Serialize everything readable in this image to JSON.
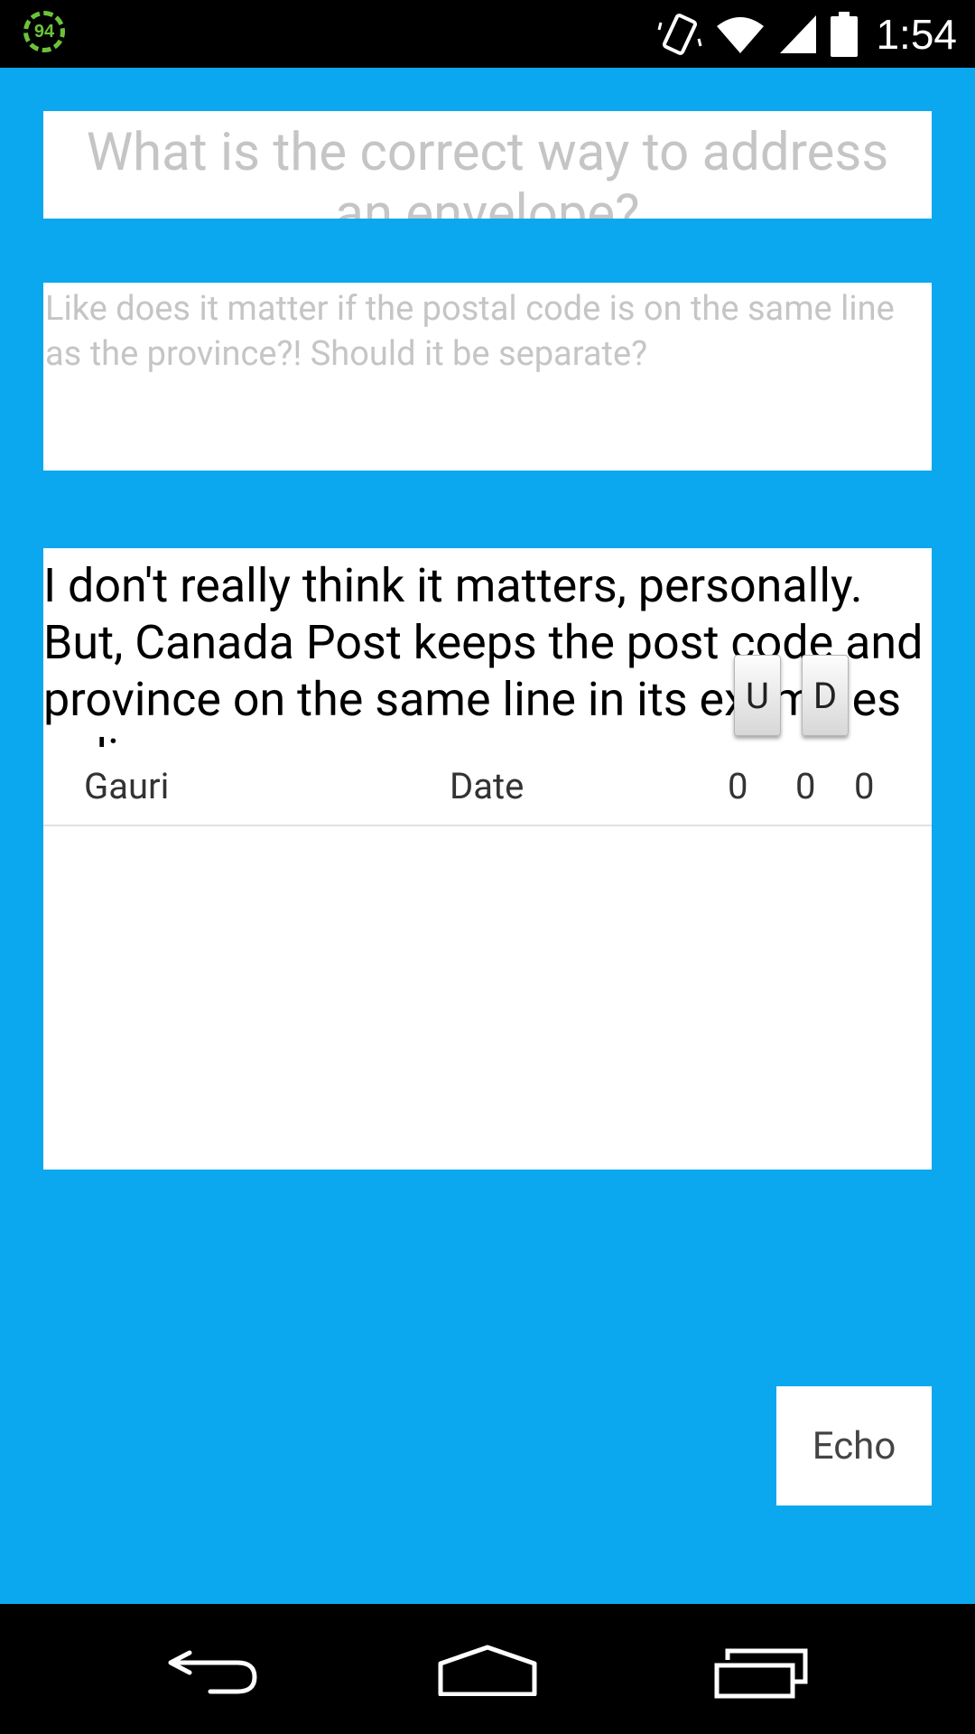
{
  "status_bar": {
    "battery_saver_level": "94",
    "time": "1:54",
    "icons": [
      "battery-saver-icon",
      "vibrate-icon",
      "wifi-icon",
      "signal-icon",
      "battery-icon"
    ]
  },
  "question": {
    "title": "What is the correct way to address an envelope?",
    "description": "Like does it matter if the postal code is on the same line as the province?! Should it be separate?"
  },
  "answer": {
    "text": "I don't really think it matters, personally. But, Canada Post keeps the post code and province on the same line in its examples online.",
    "up_label": "U",
    "down_label": "D",
    "author": "Gauri",
    "date_label": "Date",
    "counts": [
      "0",
      "0",
      "0"
    ]
  },
  "echo_button": {
    "label": "Echo"
  },
  "nav_bar": {
    "icons": [
      "back-icon",
      "home-icon",
      "recents-icon"
    ]
  },
  "colors": {
    "background": "#0ba8ef",
    "placeholder_text": "#c5c5c5"
  }
}
